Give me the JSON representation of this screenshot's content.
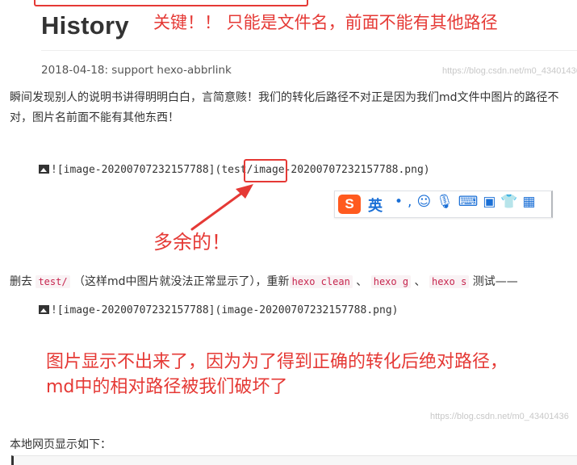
{
  "heading": "History",
  "annotations": {
    "top": "关键！！ 只能是文件名，前面不能有其他路径",
    "extra": "多余的！",
    "bottom_line1": "图片显示不出来了，因为为了得到正确的转化后绝对路径，",
    "bottom_line2": "md中的相对路径被我们破坏了"
  },
  "history_entry": "2018-04-18: support hexo-abbrlink",
  "watermark": "https://blog.csdn.net/m0_43401436",
  "paragraph1": "瞬间发现别人的说明书讲得明明白白，言简意赅！我们的转化后路径不对正是因为我们md文件中图片的路径不对，图片名前面不能有其他东西！",
  "markdown_before": {
    "prefix": "![image-20200707232157788]",
    "path_highlight": "(test/",
    "suffix": "image-20200707232157788.png)"
  },
  "ime_toolbar": {
    "logo": "S",
    "mode_label": "英",
    "icons": [
      "punctuation-icon",
      "emoji-icon",
      "microphone-icon",
      "keyboard-icon",
      "toolbox-icon",
      "skin-icon",
      "apps-grid-icon"
    ]
  },
  "paragraph2": {
    "text1": "删去",
    "code1": "test/",
    "text2": "（这样md中图片就没法正常显示了），重新",
    "code2": "hexo clean",
    "sep1": "、",
    "code3": "hexo g",
    "sep2": "、",
    "code4": "hexo s",
    "text3": "测试——"
  },
  "markdown_after": "![image-20200707232157788](image-20200707232157788.png)",
  "paragraph3": "本地网页显示如下：",
  "colors": {
    "annotation_red": "#e53935",
    "inline_code": "#c7254e",
    "inline_code_bg": "#f9f2f4",
    "ime_orange": "#ff5a1f",
    "ime_blue": "#1a6fd6"
  }
}
